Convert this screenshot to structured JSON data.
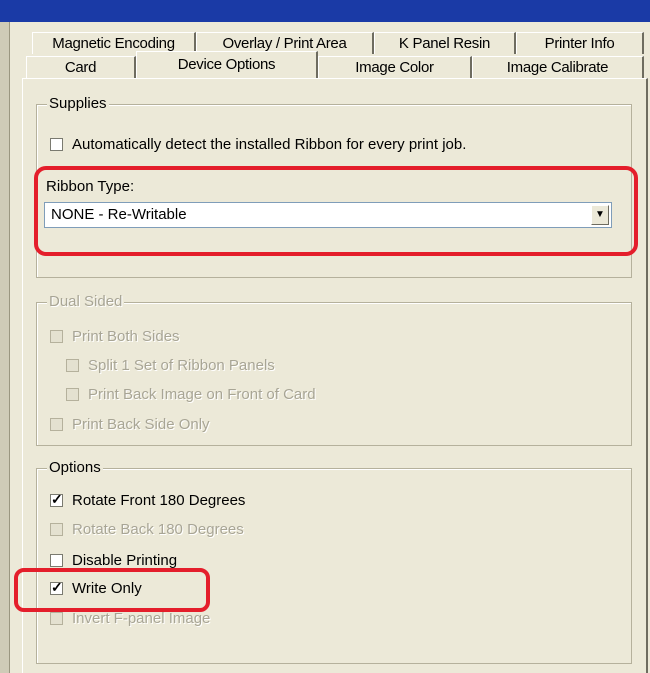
{
  "tabs_row1": [
    {
      "label": "Magnetic Encoding"
    },
    {
      "label": "Overlay / Print Area"
    },
    {
      "label": "K Panel Resin"
    },
    {
      "label": "Printer Info"
    }
  ],
  "tabs_row2": [
    {
      "label": "Card"
    },
    {
      "label": "Device Options"
    },
    {
      "label": "Image Color"
    },
    {
      "label": "Image Calibrate"
    }
  ],
  "supplies": {
    "title": "Supplies",
    "auto_detect": {
      "label": "Automatically detect the installed Ribbon for every print job.",
      "checked": false
    },
    "ribbon_type_label": "Ribbon Type:",
    "ribbon_type_value": "NONE - Re-Writable"
  },
  "dual_sided": {
    "title": "Dual Sided",
    "items": [
      {
        "label": "Print Both Sides"
      },
      {
        "label": "Split 1 Set of Ribbon Panels"
      },
      {
        "label": "Print Back Image on Front of Card"
      },
      {
        "label": "Print Back Side Only"
      }
    ]
  },
  "options": {
    "title": "Options",
    "items": [
      {
        "label": "Rotate Front 180 Degrees",
        "checked": true,
        "enabled": true
      },
      {
        "label": "Rotate Back 180 Degrees",
        "checked": false,
        "enabled": false
      },
      {
        "label": "Disable Printing",
        "checked": false,
        "enabled": true
      },
      {
        "label": "Write Only",
        "checked": true,
        "enabled": true
      },
      {
        "label": "Invert F-panel Image",
        "checked": false,
        "enabled": false
      }
    ]
  },
  "colors": {
    "highlight": "#e41e2b",
    "titlebar": "#1a3aa6",
    "dialog": "#ece9d8"
  }
}
